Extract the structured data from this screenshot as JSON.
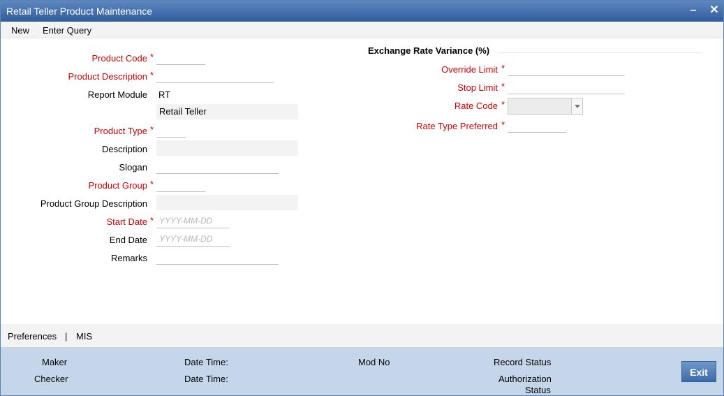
{
  "window": {
    "title": "Retail Teller Product Maintenance",
    "minimize": "–",
    "close": "✕"
  },
  "menu": {
    "new": "New",
    "enter_query": "Enter Query"
  },
  "form": {
    "product_code": {
      "label": "Product Code",
      "value": ""
    },
    "product_description": {
      "label": "Product Description",
      "value": ""
    },
    "report_module": {
      "label": "Report Module",
      "value": "RT",
      "description": "Retail Teller"
    },
    "product_type": {
      "label": "Product Type",
      "value": ""
    },
    "description": {
      "label": "Description",
      "value": ""
    },
    "slogan": {
      "label": "Slogan",
      "value": ""
    },
    "product_group": {
      "label": "Product Group",
      "value": ""
    },
    "product_group_description": {
      "label": "Product Group Description",
      "value": ""
    },
    "start_date": {
      "label": "Start Date",
      "placeholder": "YYYY-MM-DD"
    },
    "end_date": {
      "label": "End Date",
      "placeholder": "YYYY-MM-DD"
    },
    "remarks": {
      "label": "Remarks",
      "value": ""
    },
    "required_mark": "*"
  },
  "exchange": {
    "section_title": "Exchange Rate Variance (%)",
    "override_limit": {
      "label": "Override Limit",
      "value": ""
    },
    "stop_limit": {
      "label": "Stop Limit",
      "value": ""
    },
    "rate_code": {
      "label": "Rate Code",
      "value": ""
    },
    "rate_type_preferred": {
      "label": "Rate Type Preferred",
      "value": ""
    }
  },
  "tabs": {
    "preferences": "Preferences",
    "separator": "|",
    "mis": "MIS"
  },
  "audit": {
    "maker": "Maker",
    "checker": "Checker",
    "date_time_1": "Date Time:",
    "date_time_2": "Date Time:",
    "mod_no": "Mod No",
    "record_status": "Record Status",
    "authorization_status_line1": "Authorization",
    "authorization_status_line2": "Status",
    "exit": "Exit"
  },
  "colors": {
    "title_bar": "#2f5c9c",
    "required": "#d40000",
    "footer": "#c5d6ea",
    "exit_button": "#3e6ca8"
  }
}
